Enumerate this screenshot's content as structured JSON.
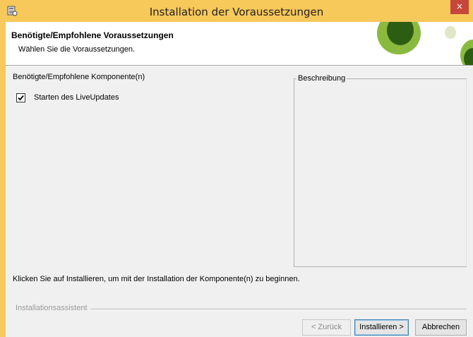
{
  "window": {
    "title": "Installation der Voraussetzungen",
    "close_symbol": "×",
    "title_bar_color": "#f7c85a",
    "close_button_color": "#c7463a"
  },
  "header": {
    "title": "Benötigte/Empfohlene Voraussetzungen",
    "subtitle": "Wählen Sie die Voraussetzungen.",
    "logo_colors": [
      "#8ab93f",
      "#2d5d13",
      "#dfe7c6"
    ]
  },
  "components": {
    "label": "Benötigte/Empfohlene Komponente(n)",
    "items": [
      {
        "label": "Starten des LiveUpdates",
        "checked": true
      }
    ]
  },
  "description": {
    "legend": "Beschreibung"
  },
  "hint": "Klicken Sie auf Installieren, um mit der Installation der Komponente(n) zu beginnen.",
  "footer": {
    "assistant_label": "Installationsassistent",
    "back_label": "< Zurück",
    "install_label": "Installieren >",
    "cancel_label": "Abbrechen"
  },
  "icons": {
    "app": "installer-icon",
    "close": "close-icon",
    "check": "checkmark-icon"
  }
}
